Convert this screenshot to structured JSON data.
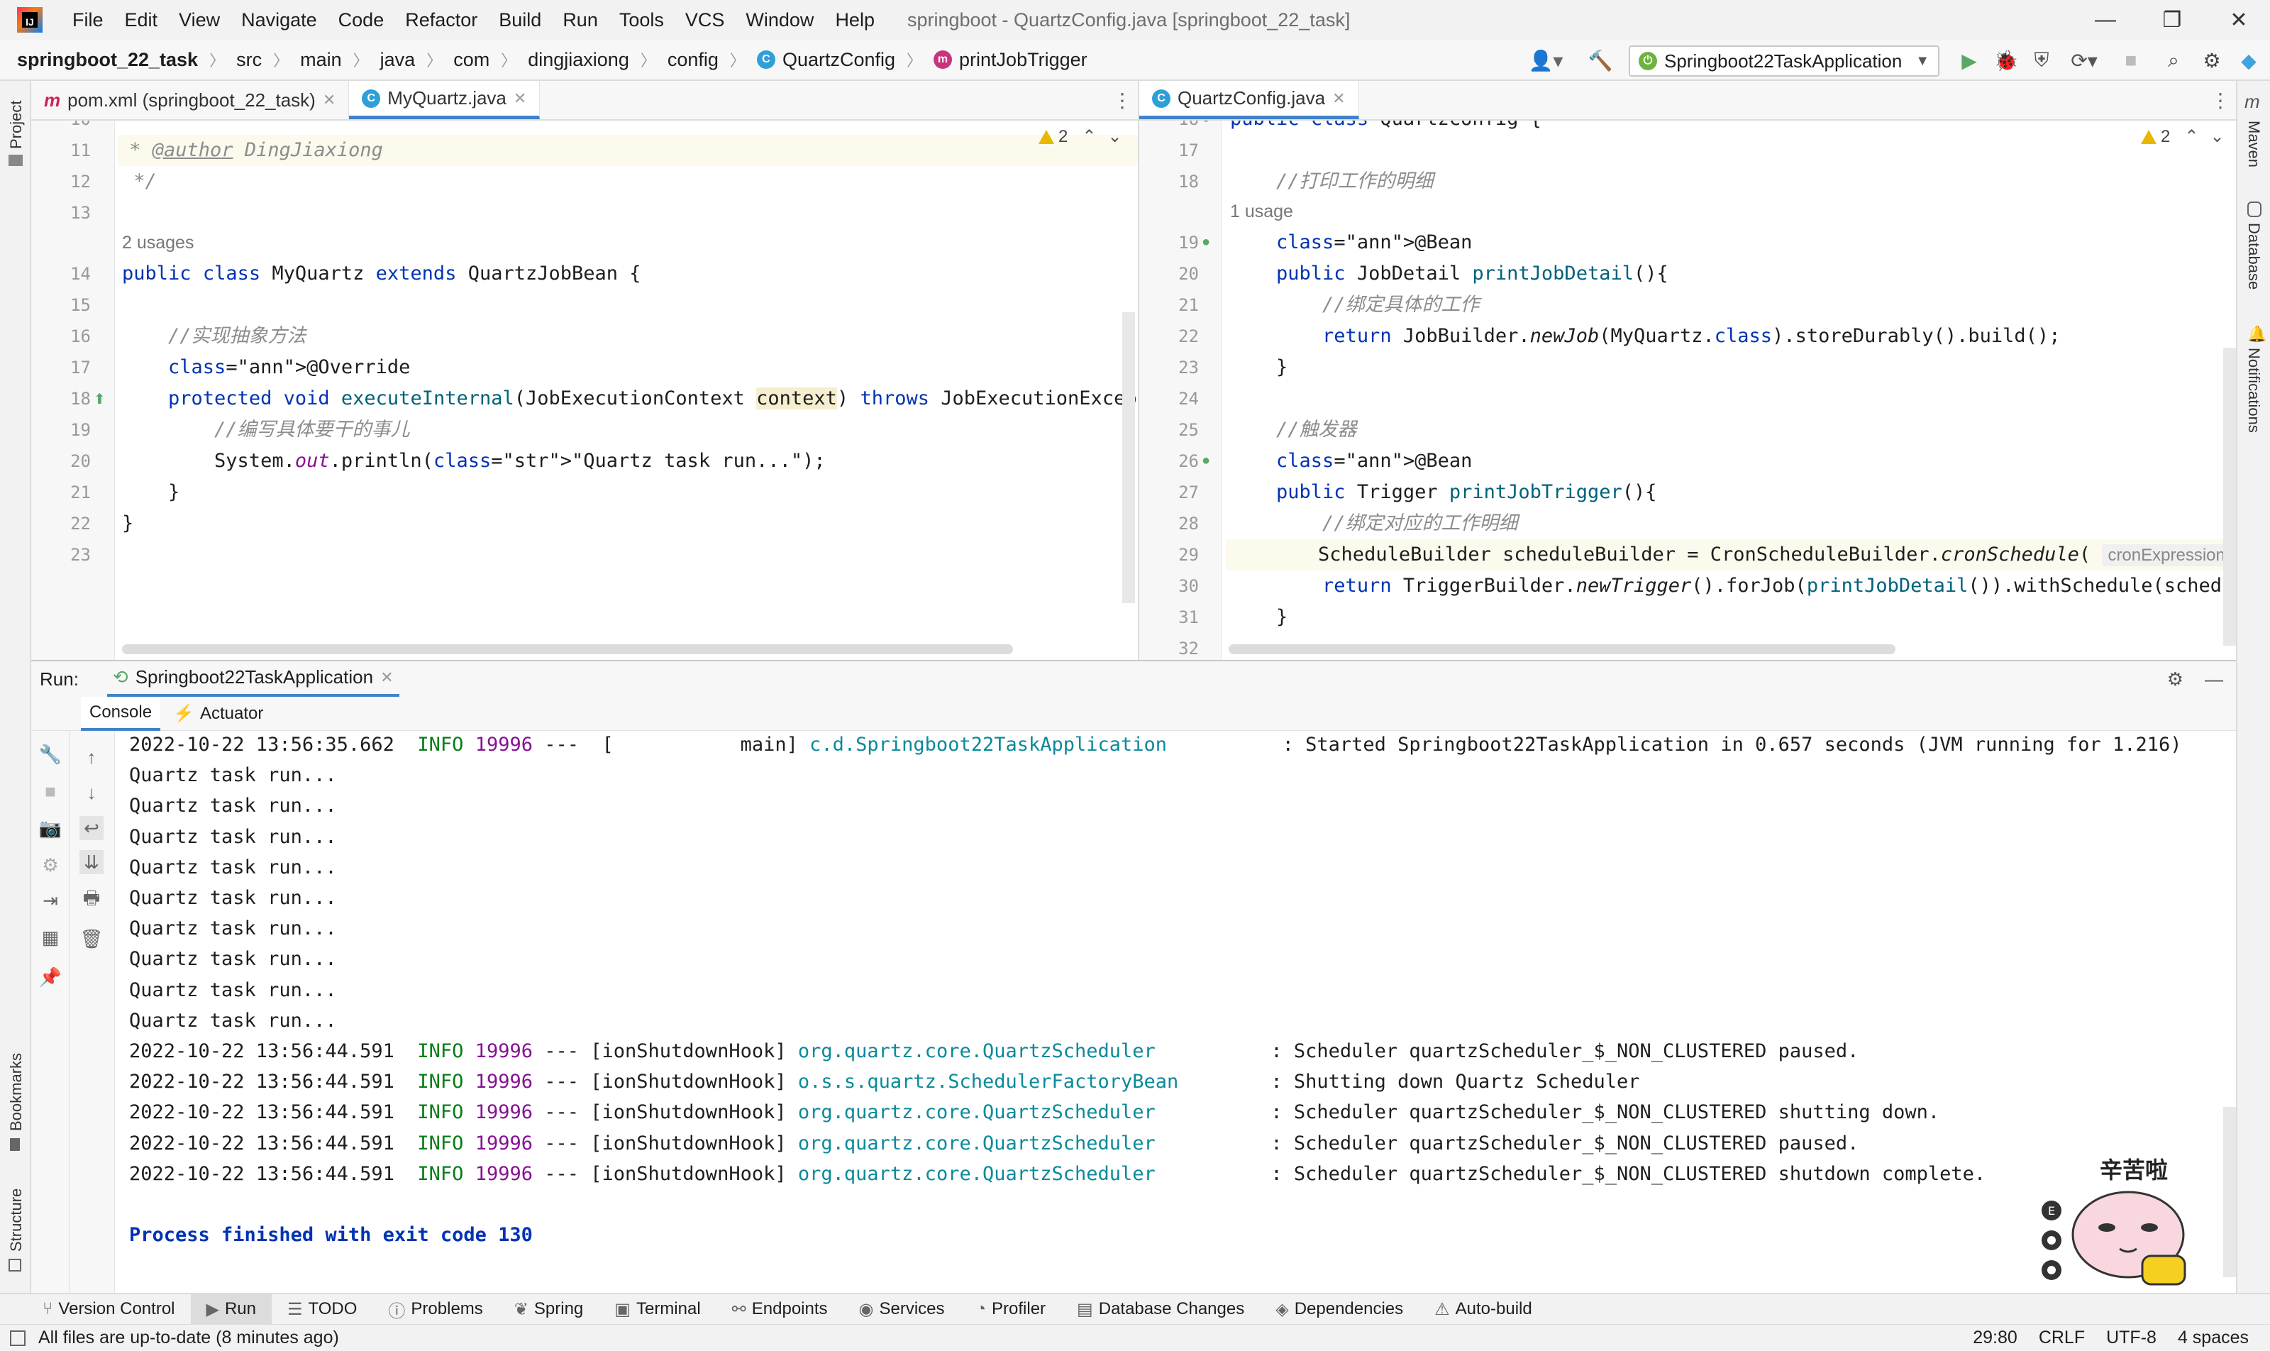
{
  "window": {
    "title": "springboot - QuartzConfig.java [springboot_22_task]",
    "menu": [
      "File",
      "Edit",
      "View",
      "Navigate",
      "Code",
      "Refactor",
      "Build",
      "Run",
      "Tools",
      "VCS",
      "Window",
      "Help"
    ]
  },
  "breadcrumb": [
    "springboot_22_task",
    "src",
    "main",
    "java",
    "com",
    "dingjiaxiong",
    "config",
    "QuartzConfig",
    "printJobTrigger"
  ],
  "run_config": "Springboot22TaskApplication",
  "left_tools": [
    "Project",
    "Bookmarks",
    "Structure"
  ],
  "right_tools": [
    "Maven",
    "Database",
    "Notifications"
  ],
  "left_editor": {
    "tabs": [
      {
        "label": "pom.xml (springboot_22_task)",
        "icon": "maven-icon"
      },
      {
        "label": "MyQuartz.java",
        "icon": "class-icon"
      }
    ],
    "warnings": "2",
    "lines": [
      {
        "n": "10",
        "t": " *"
      },
      {
        "n": "11",
        "t": " * @author DingJiaxiong"
      },
      {
        "n": "12",
        "t": " */"
      },
      {
        "n": "13",
        "t": ""
      },
      {
        "n": "14",
        "t": "public class MyQuartz extends QuartzJobBean {"
      },
      {
        "n": "15",
        "t": ""
      },
      {
        "n": "16",
        "t": "    //实现抽象方法"
      },
      {
        "n": "17",
        "t": "    @Override"
      },
      {
        "n": "18",
        "t": "    protected void executeInternal(JobExecutionContext context) throws JobExecutionExcept:"
      },
      {
        "n": "19",
        "t": "        //编写具体要干的事儿"
      },
      {
        "n": "20",
        "t": "        System.out.println(\"Quartz task run...\");"
      },
      {
        "n": "21",
        "t": "    }"
      },
      {
        "n": "22",
        "t": "}"
      },
      {
        "n": "23",
        "t": ""
      }
    ],
    "usage_hint": "2 usages"
  },
  "right_editor": {
    "tabs": [
      {
        "label": "QuartzConfig.java",
        "icon": "class-icon"
      }
    ],
    "warnings": "2",
    "lines": [
      {
        "n": "16",
        "t": "public class QuartzConfig {"
      },
      {
        "n": "17",
        "t": ""
      },
      {
        "n": "18",
        "t": "    //打印工作的明细"
      },
      {
        "n": "19",
        "t": "    @Bean"
      },
      {
        "n": "20",
        "t": "    public JobDetail printJobDetail(){"
      },
      {
        "n": "21",
        "t": "        //绑定具体的工作"
      },
      {
        "n": "22",
        "t": "        return JobBuilder.newJob(MyQuartz.class).storeDurably().build();"
      },
      {
        "n": "23",
        "t": "    }"
      },
      {
        "n": "24",
        "t": ""
      },
      {
        "n": "25",
        "t": "    //触发器"
      },
      {
        "n": "26",
        "t": "    @Bean"
      },
      {
        "n": "27",
        "t": "    public Trigger printJobTrigger(){"
      },
      {
        "n": "28",
        "t": "        //绑定对应的工作明细"
      },
      {
        "n": "29",
        "t": "        ScheduleBuilder scheduleBuilder = CronScheduleBuilder.cronSchedule( cronExpression: \"("
      },
      {
        "n": "30",
        "t": "        return TriggerBuilder.newTrigger().forJob(printJobDetail()).withSchedule(schedule"
      },
      {
        "n": "31",
        "t": "    }"
      },
      {
        "n": "32",
        "t": ""
      }
    ],
    "usage_hint": "1 usage",
    "param_hint": "cronExpression:"
  },
  "run_panel": {
    "label": "Run:",
    "tab": "Springboot22TaskApplication",
    "subtabs": [
      "Console",
      "Actuator"
    ],
    "console": [
      {
        "ts": "2022-10-22 13:56:35.662",
        "lvl": "INFO",
        "pid": "19996",
        "thread": "---  [           main]",
        "logger": "c.d.Springboot22TaskApplication         ",
        "msg": ": Started Springboot22TaskApplication in 0.657 seconds (JVM running for 1.216)"
      },
      {
        "plain": "Quartz task run..."
      },
      {
        "plain": "Quartz task run..."
      },
      {
        "plain": "Quartz task run..."
      },
      {
        "plain": "Quartz task run..."
      },
      {
        "plain": "Quartz task run..."
      },
      {
        "plain": "Quartz task run..."
      },
      {
        "plain": "Quartz task run..."
      },
      {
        "plain": "Quartz task run..."
      },
      {
        "plain": "Quartz task run..."
      },
      {
        "ts": "2022-10-22 13:56:44.591",
        "lvl": "INFO",
        "pid": "19996",
        "thread": "--- [ionShutdownHook]",
        "logger": "org.quartz.core.QuartzScheduler         ",
        "msg": ": Scheduler quartzScheduler_$_NON_CLUSTERED paused."
      },
      {
        "ts": "2022-10-22 13:56:44.591",
        "lvl": "INFO",
        "pid": "19996",
        "thread": "--- [ionShutdownHook]",
        "logger": "o.s.s.quartz.SchedulerFactoryBean       ",
        "msg": ": Shutting down Quartz Scheduler"
      },
      {
        "ts": "2022-10-22 13:56:44.591",
        "lvl": "INFO",
        "pid": "19996",
        "thread": "--- [ionShutdownHook]",
        "logger": "org.quartz.core.QuartzScheduler         ",
        "msg": ": Scheduler quartzScheduler_$_NON_CLUSTERED shutting down."
      },
      {
        "ts": "2022-10-22 13:56:44.591",
        "lvl": "INFO",
        "pid": "19996",
        "thread": "--- [ionShutdownHook]",
        "logger": "org.quartz.core.QuartzScheduler         ",
        "msg": ": Scheduler quartzScheduler_$_NON_CLUSTERED paused."
      },
      {
        "ts": "2022-10-22 13:56:44.591",
        "lvl": "INFO",
        "pid": "19996",
        "thread": "--- [ionShutdownHook]",
        "logger": "org.quartz.core.QuartzScheduler         ",
        "msg": ": Scheduler quartzScheduler_$_NON_CLUSTERED shutdown complete."
      },
      {
        "plain": ""
      },
      {
        "end": "Process finished with exit code 130"
      }
    ],
    "sticker_text": "辛苦啦"
  },
  "bottom_tools": [
    "Version Control",
    "Run",
    "TODO",
    "Problems",
    "Spring",
    "Terminal",
    "Endpoints",
    "Services",
    "Profiler",
    "Database Changes",
    "Dependencies",
    "Auto-build"
  ],
  "status": {
    "message": "All files are up-to-date (8 minutes ago)",
    "position": "29:80",
    "line_sep": "CRLF",
    "encoding": "UTF-8",
    "indent": "4 spaces"
  },
  "colors": {
    "accent": "#4083c9",
    "keyword": "#0033b3",
    "string": "#067d17",
    "annotation": "#9e880d",
    "run_green": "#59a869"
  }
}
